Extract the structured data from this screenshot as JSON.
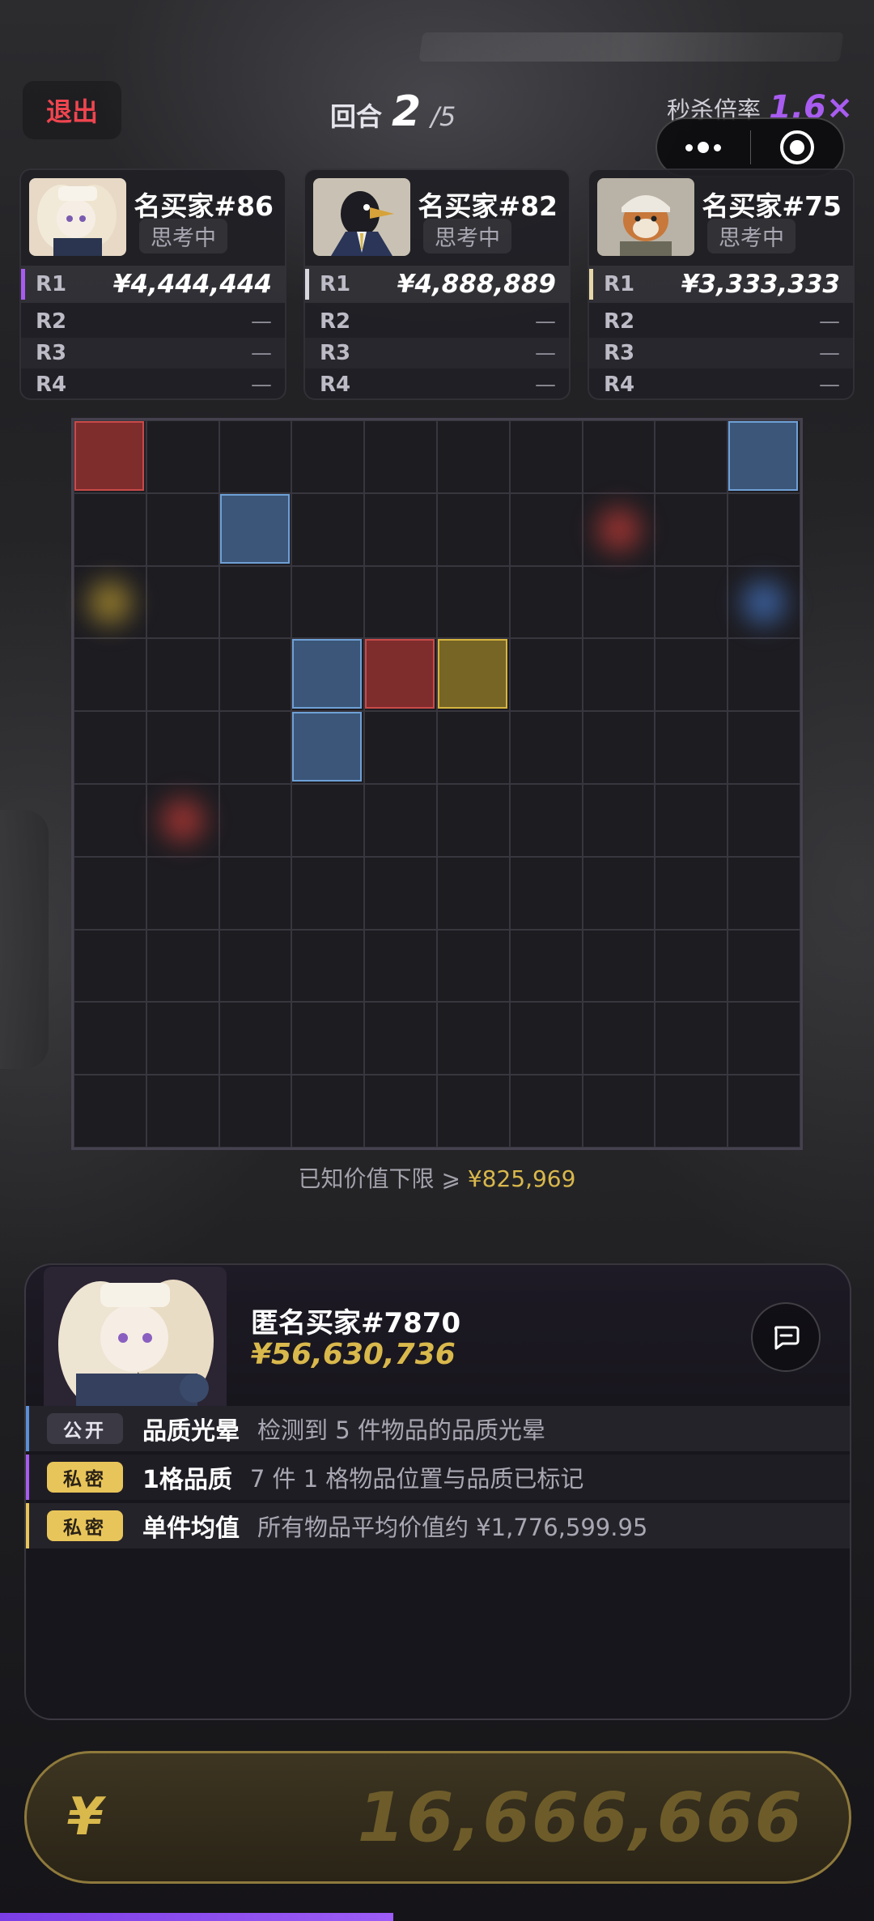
{
  "header": {
    "exit_label": "退出",
    "round_label": "回合",
    "round_current": "2",
    "round_total": "/5",
    "kill_label": "秒杀倍率",
    "kill_value": "1.6×"
  },
  "buyers": [
    {
      "name": "名买家#86",
      "status": "思考中",
      "accent": "#a75cf0",
      "rounds": [
        {
          "label": "R1",
          "value": "¥4,444,444"
        },
        {
          "label": "R2",
          "value": "—"
        },
        {
          "label": "R3",
          "value": "—"
        },
        {
          "label": "R4",
          "value": "—"
        }
      ]
    },
    {
      "name": "名买家#82",
      "status": "思考中",
      "accent": "#d8d6de",
      "rounds": [
        {
          "label": "R1",
          "value": "¥4,888,889"
        },
        {
          "label": "R2",
          "value": "—"
        },
        {
          "label": "R3",
          "value": "—"
        },
        {
          "label": "R4",
          "value": "—"
        }
      ]
    },
    {
      "name": "名买家#75",
      "status": "思考中",
      "accent": "#e8d7a8",
      "rounds": [
        {
          "label": "R1",
          "value": "¥3,333,333"
        },
        {
          "label": "R2",
          "value": "—"
        },
        {
          "label": "R3",
          "value": "—"
        },
        {
          "label": "R4",
          "value": "—"
        }
      ]
    }
  ],
  "grid": {
    "rows": 10,
    "cols": 10,
    "items": [
      {
        "row": 0,
        "col": 0,
        "quality": "red"
      },
      {
        "row": 0,
        "col": 9,
        "quality": "blue"
      },
      {
        "row": 1,
        "col": 2,
        "quality": "blue"
      },
      {
        "row": 3,
        "col": 3,
        "quality": "blue"
      },
      {
        "row": 3,
        "col": 4,
        "quality": "red"
      },
      {
        "row": 3,
        "col": 5,
        "quality": "gold"
      },
      {
        "row": 4,
        "col": 3,
        "quality": "blue"
      }
    ],
    "halos": [
      {
        "row": 1,
        "col": 7,
        "quality": "red"
      },
      {
        "row": 2,
        "col": 0,
        "quality": "gold"
      },
      {
        "row": 2,
        "col": 9,
        "quality": "blue"
      },
      {
        "row": 5,
        "col": 1,
        "quality": "red"
      }
    ]
  },
  "known_value": {
    "label": "已知价值下限 ⩾",
    "value": "¥825,969"
  },
  "me": {
    "name": "匿名买家#7870",
    "cash": "¥56,630,736",
    "intel": [
      {
        "tag": "公开",
        "title": "品质光晕",
        "desc": "检测到 5 件物品的品质光晕",
        "accent": "#5b8fd6"
      },
      {
        "tag": "私密",
        "title": "1格品质",
        "desc": "7 件 1 格物品位置与品质已标记",
        "accent": "#a75cf0"
      },
      {
        "tag": "私密",
        "title": "单件均值",
        "desc": "所有物品平均价值约 ¥1,776,599.95",
        "accent": "#e8c55a"
      }
    ]
  },
  "bid": {
    "currency": "¥",
    "amount": "16,666,666"
  },
  "timer_progress": 0.45
}
